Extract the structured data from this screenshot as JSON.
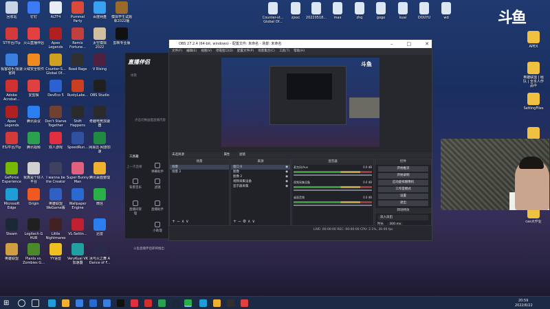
{
  "desktop_left": [
    {
      "label": "回收站",
      "color": "#c9d4e6"
    },
    {
      "label": "钉钉",
      "color": "#3b7bf6"
    },
    {
      "label": "ALTF4",
      "color": "#e9eef6"
    },
    {
      "label": "Pummel Party",
      "color": "#d94a3a"
    },
    {
      "label": "百度网盘",
      "color": "#3aa0f0"
    },
    {
      "label": "模拟学生试题库2022版",
      "color": "#9a6a2a"
    },
    {
      "label": "ST平台/Tip",
      "color": "#d33a3a"
    },
    {
      "label": "火山直播伴侣",
      "color": "#e44040"
    },
    {
      "label": "Apex Legends",
      "color": "#b02020"
    },
    {
      "label": "Remix Fortune...",
      "color": "#c04040"
    },
    {
      "label": "太空模拟 2022",
      "color": "#d0c0a0"
    },
    {
      "label": "剪映专业版",
      "color": "#111111"
    },
    {
      "label": "极客助手/极速官网",
      "color": "#3a7ee0"
    },
    {
      "label": "火绒安全软件",
      "color": "#f08a20"
    },
    {
      "label": "Counter-S... Global Of...",
      "color": "#d0a020"
    },
    {
      "label": "Road Rage",
      "color": "#303030"
    },
    {
      "label": "V Rising",
      "color": "#502040"
    },
    {
      "label": "Adobe Acrobat...",
      "color": "#d03030"
    },
    {
      "label": "爱剪辑",
      "color": "#e04040"
    },
    {
      "label": "DevEco 5",
      "color": "#2b62d0"
    },
    {
      "label": "RustyLake...",
      "color": "#c84020"
    },
    {
      "label": "OBS Studio",
      "color": "#202020"
    },
    {
      "label": "Apex Legends",
      "color": "#b02020"
    },
    {
      "label": "腾讯会议",
      "color": "#2a7ef0"
    },
    {
      "label": "Don't Starve Together",
      "color": "#704030"
    },
    {
      "label": "Shift Happens",
      "color": "#2a2a2a"
    },
    {
      "label": "奇趣电竞加速器",
      "color": "#2a2a2a"
    },
    {
      "label": "ES/平台/Tip",
      "color": "#d33a3a"
    },
    {
      "label": "腾讯视频",
      "color": "#2aa050"
    },
    {
      "label": "双人游戏",
      "color": "#e03040"
    },
    {
      "label": "SpeedRun...",
      "color": "#3050a0"
    },
    {
      "label": "网易云·网游加速",
      "color": "#1f8a40"
    },
    {
      "label": "GeForce Experience",
      "color": "#76b900"
    },
    {
      "label": "我真是个好人平台",
      "color": "#d0d0d0"
    },
    {
      "label": "I wanna be the Creator",
      "color": "#404060"
    },
    {
      "label": "Super Bunny Man",
      "color": "#e06080"
    },
    {
      "label": "腾讯桌面整理",
      "color": "#f0b030"
    },
    {
      "label": "Microsoft Edge",
      "color": "#1f9ed6"
    },
    {
      "label": "Origin",
      "color": "#f05a20"
    },
    {
      "label": "英雄联盟 WeGame版",
      "color": "#3060c0"
    },
    {
      "label": "Wallpaper Engine",
      "color": "#2a6ad0"
    },
    {
      "label": "微信",
      "color": "#2aae4a"
    },
    {
      "label": "Steam",
      "color": "#1b2838"
    },
    {
      "label": "Logitech G HUB",
      "color": "#202020"
    },
    {
      "label": "Little Nightmares",
      "color": "#402020"
    },
    {
      "label": "VL-Settin...",
      "color": "#c02030"
    },
    {
      "label": "迅雷",
      "color": "#2a7ef0"
    },
    {
      "label": "英雄联盟",
      "color": "#d0a040"
    },
    {
      "label": "Plants vs. Zombies G...",
      "color": "#4a8a2a"
    },
    {
      "label": "YY语音",
      "color": "#f0c020"
    },
    {
      "label": "VeryKuai VK加速器",
      "color": "#20a0a0"
    },
    {
      "label": "冰与火之舞 A Dance of F...",
      "color": "#2a2a4a"
    }
  ],
  "desktop_top": [
    {
      "label": "Counter-st... Global Of..."
    },
    {
      "label": "zjxxc"
    },
    {
      "label": "20220518..."
    },
    {
      "label": "max"
    },
    {
      "label": "zhq"
    },
    {
      "label": "gogo"
    },
    {
      "label": "kuai"
    },
    {
      "label": "DOUYU"
    },
    {
      "label": "wd"
    }
  ],
  "desktop_right": [
    {
      "label": "APEX"
    },
    {
      "label": "英雄联盟 | 组队 | 全本人作品中"
    },
    {
      "label": "SettingFiles"
    },
    {
      "label": "暴力练习"
    },
    {
      "label": "cas大作业"
    }
  ],
  "brand": "斗鱼",
  "zb": {
    "title": "直播伴侣",
    "btn1": "场景",
    "sidebar": {
      "tab1": "工具箱",
      "tab2": "上一次直播",
      "items": [
        {
          "label": "弹幕助手"
        },
        {
          "label": "背景音乐"
        },
        {
          "label": "滤镜"
        },
        {
          "label": "直播间管理"
        },
        {
          "label": "直播助手"
        },
        {
          "label": "小助理"
        }
      ]
    },
    "hint": "点击切换画面直播内容",
    "status": "斗鱼直播伴侣即将推出"
  },
  "obs": {
    "title": "OBS 27.2.4 (64-bit, windows) - 配置文件: 未命名 - 场景: 未命名",
    "menu": [
      "文件(F)",
      "编辑(E)",
      "视图(V)",
      "停靠窗口(D)",
      "配置文件(P)",
      "场景集合(C)",
      "工具(T)",
      "帮助(H)"
    ],
    "scene_bar": [
      "未选择源",
      "属性",
      "滤镜"
    ],
    "docks": {
      "scenes": "场景",
      "sources": "来源",
      "mixer": "混音器",
      "controls": "控件"
    },
    "scenes": [
      "场景",
      "场景 2"
    ],
    "sources": [
      {
        "label": "窗口 6",
        "sel": true
      },
      {
        "label": "图像",
        "sel": false
      },
      {
        "label": "图像 2",
        "sel": false
      },
      {
        "label": "视频采集设备",
        "sel": false
      },
      {
        "label": "显示器采集",
        "sel": false
      }
    ],
    "mixer": [
      {
        "name": "麦克风/Aux",
        "db": "0.0 dB"
      },
      {
        "name": "视频采集设备",
        "db": "0.0 dB"
      },
      {
        "name": "桌面音频",
        "db": "0.0 dB"
      }
    ],
    "controls": [
      "开始推流",
      "开始录制",
      "启动虚拟摄像机",
      "工作室模式",
      "设置",
      "退出"
    ],
    "transition": {
      "title": "转场特效",
      "type": "淡入淡出",
      "duration_label": "时长",
      "duration": "300 ms"
    },
    "status": "LIVE: 00:00:00  REC: 00:00:00  CPU: 2.1%, 30.00 fps"
  },
  "taskbar": {
    "time": "20:59",
    "date": "2022/6/22"
  }
}
